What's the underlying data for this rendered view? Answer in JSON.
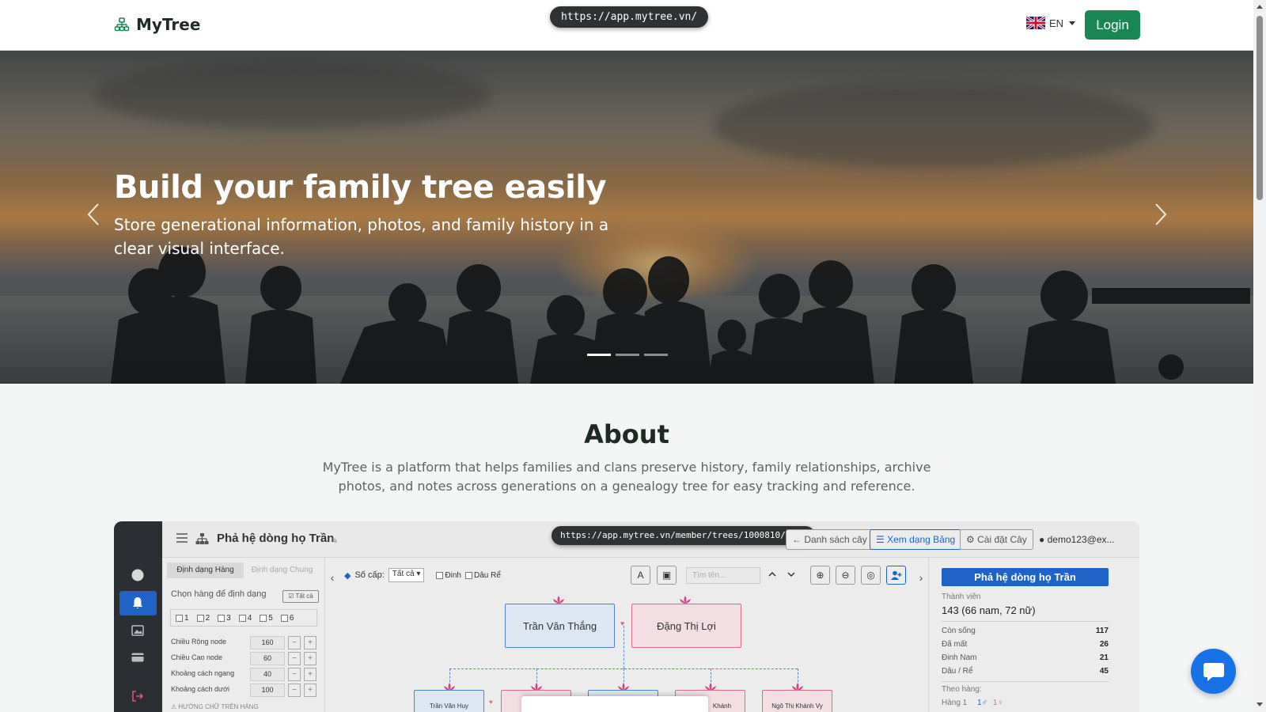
{
  "browser": {
    "url_top": "https://app.mytree.vn/"
  },
  "header": {
    "brand": "MyTree",
    "language": "EN",
    "login_label": "Login"
  },
  "hero": {
    "title": "Build your family tree easily",
    "subtitle": "Store generational information, photos, and family history in a clear visual interface.",
    "slide_count": 3,
    "active_slide": 1
  },
  "about": {
    "title": "About",
    "text": "MyTree is a platform that helps families and clans preserve history, family relationships, archive photos, and notes across generations on a genealogy tree for easy tracking and reference."
  },
  "preview": {
    "url": "https://app.mytree.vn/member/trees/1000810/view",
    "tree_title": "Phả hệ dòng họ Trần",
    "topbar": {
      "list_btn": "Danh sách cây",
      "table_btn": "Xem dạng Bảng",
      "settings_btn": "Cài đặt Cây",
      "user": "demo123@ex..."
    },
    "left_panel": {
      "tab_row": "Định dạng Hàng",
      "tab_common": "Định dạng Chung",
      "choose_row": "Chọn hàng để định dạng",
      "all_btn": "Tất cả",
      "rows": [
        "1",
        "2",
        "3",
        "4",
        "5",
        "6"
      ],
      "fields": [
        {
          "label": "Chiều Rộng node",
          "value": "160"
        },
        {
          "label": "Chiều Cao node",
          "value": "60"
        },
        {
          "label": "Khoảng cách ngang",
          "value": "40"
        },
        {
          "label": "Khoảng cách dưới",
          "value": "100"
        }
      ],
      "minus": "−",
      "plus": "+",
      "truncated": "⚠ HƯỚNG CHỮ TRÊN HÀNG"
    },
    "toolbar": {
      "level_label": "Số cấp:",
      "level_value": "Tất cả",
      "chk_dinh": "Đinh",
      "chk_dau": "Dâu Rể",
      "search_placeholder": "Tìm tên...",
      "text_btn": "A"
    },
    "tree": {
      "root_male": "Trần Văn Thắng",
      "root_female": "Đặng Thị Lợi",
      "child_1": "Trần Văn Huy",
      "child_4": "Khánh",
      "child_5": "Ngô Thị Khánh Vy"
    },
    "right_panel": {
      "tree_btn": "Phả hệ dòng họ Trần",
      "members_label": "Thành viên",
      "members_value": "143 (66 nam, 72 nữ)",
      "stats": [
        {
          "label": "Còn sống",
          "value": "117"
        },
        {
          "label": "Đã mất",
          "value": "26"
        },
        {
          "label": "Đinh Nam",
          "value": "21"
        },
        {
          "label": "Dâu / Rể",
          "value": "45"
        }
      ],
      "by_gen_label": "Theo hàng:",
      "gen_1": "Hàng 1",
      "gen_1_male": "1♂",
      "gen_1_female": "1♀"
    }
  },
  "colors": {
    "brand_green": "#198754",
    "accent_blue": "#1773e5",
    "tree_blue": "#1f63c6",
    "male_node": "#dde6f3",
    "female_node": "#f3dee3"
  }
}
